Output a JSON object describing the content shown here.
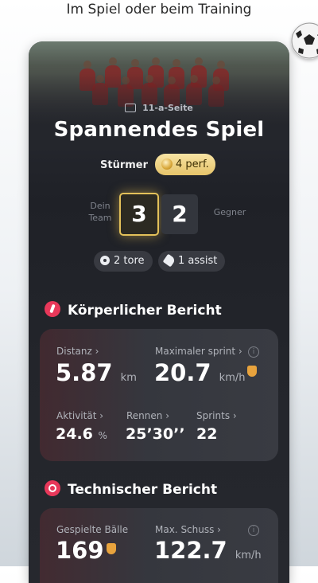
{
  "caption": "Im Spiel oder beim Training",
  "match": {
    "type": "11-a-Seite",
    "title": "Spannendes Spiel",
    "position": "Stürmer",
    "performance_badge": "4 perf.",
    "team_label": "Dein Team",
    "opponent_label": "Gegner",
    "team_score": "3",
    "opponent_score": "2",
    "goals": "2 tore",
    "assists": "1 assist"
  },
  "physical": {
    "title": "Körperlicher Bericht",
    "distance_label": "Distanz ›",
    "distance_value": "5.87",
    "distance_unit": "km",
    "max_sprint_label": "Maximaler sprint ›",
    "max_sprint_value": "20.7",
    "max_sprint_unit": "km/h",
    "activity_label": "Aktivität ›",
    "activity_value": "24.6",
    "activity_unit": "%",
    "run_label": "Rennen ›",
    "run_value": "25’30’’",
    "sprints_label": "Sprints ›",
    "sprints_value": "22"
  },
  "technical": {
    "title": "Technischer Bericht",
    "balls_label": "Gespielte Bälle",
    "balls_value": "169",
    "shot_label": "Max. Schuss ›",
    "shot_value": "122.7",
    "shot_unit": "km/h"
  },
  "icons": {
    "ball": "soccer-ball-icon",
    "pitch": "pitch-icon",
    "medal": "medal-icon",
    "goals": "ball-icon",
    "assist": "boot-icon",
    "physical": "running-icon",
    "technical": "soccer-ball-icon",
    "info": "info-icon",
    "record": "shield-icon"
  },
  "colors": {
    "accent_gold": "#e3c15a",
    "section_icon": "#e8385a",
    "record_badge": "#e8a33d"
  }
}
